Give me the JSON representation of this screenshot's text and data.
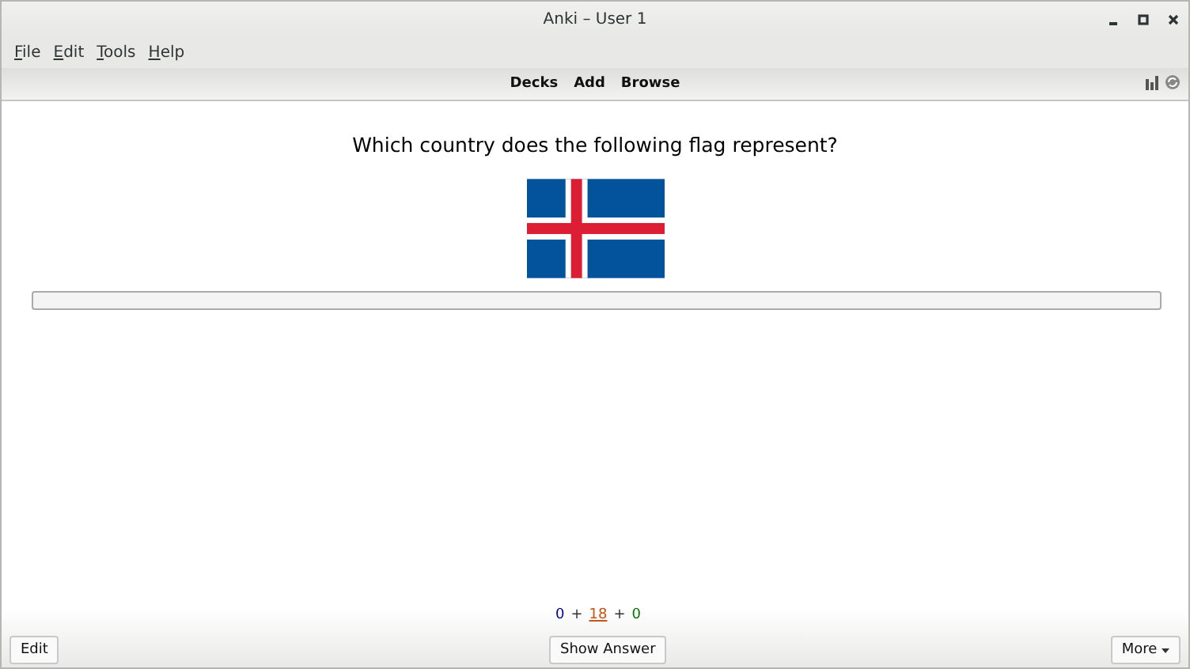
{
  "window": {
    "title": "Anki – User 1"
  },
  "menu": [
    "File",
    "Edit",
    "Tools",
    "Help"
  ],
  "toolbar": [
    "Decks",
    "Add",
    "Browse"
  ],
  "card": {
    "question": "Which country does the following flag represent?"
  },
  "counts": {
    "separator": "+",
    "items": [
      {
        "value": "0",
        "color": "#00009f",
        "selected": false
      },
      {
        "value": "18",
        "color": "#c35617",
        "selected": true
      },
      {
        "value": "0",
        "color": "#007700",
        "selected": false
      }
    ]
  },
  "buttons": {
    "edit": "Edit",
    "answer": "Show Answer",
    "more": "More"
  }
}
